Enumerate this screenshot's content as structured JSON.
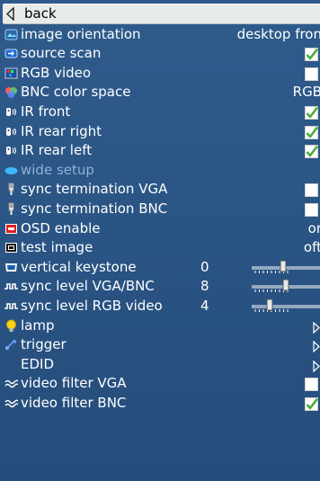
{
  "menu": {
    "back_label": "back",
    "items": [
      {
        "label": "image orientation",
        "value": "desktop fron",
        "icon": "image-orientation-icon",
        "kind": "value"
      },
      {
        "label": "source scan",
        "checked": true,
        "icon": "source-scan-icon",
        "kind": "check"
      },
      {
        "label": "RGB video",
        "checked": false,
        "icon": "rgb-video-icon",
        "kind": "check"
      },
      {
        "label": "BNC color space",
        "value": "RGB",
        "icon": "bnc-color-space-icon",
        "kind": "value"
      },
      {
        "label": "IR front",
        "checked": true,
        "icon": "ir-sensor-icon",
        "kind": "check"
      },
      {
        "label": "IR rear right",
        "checked": true,
        "icon": "ir-sensor-icon",
        "kind": "check"
      },
      {
        "label": "IR rear left",
        "checked": true,
        "icon": "ir-sensor-icon",
        "kind": "check"
      },
      {
        "label": "wide setup",
        "icon": "wide-setup-icon",
        "kind": "disabled"
      },
      {
        "label": "sync termination VGA",
        "checked": false,
        "icon": "sync-termination-icon",
        "kind": "check"
      },
      {
        "label": "sync termination BNC",
        "checked": false,
        "icon": "sync-termination-icon",
        "kind": "check"
      },
      {
        "label": "OSD enable",
        "value": "or",
        "icon": "osd-enable-icon",
        "kind": "value"
      },
      {
        "label": "test image",
        "value": "oft",
        "icon": "test-image-icon",
        "kind": "value"
      },
      {
        "label": "vertical keystone",
        "number": "0",
        "slider_fraction": 0.5,
        "icon": "vertical-keystone-icon",
        "kind": "slider"
      },
      {
        "label": "sync level VGA/BNC",
        "number": "8",
        "slider_fraction": 0.55,
        "icon": "sync-level-icon",
        "kind": "slider"
      },
      {
        "label": "sync level RGB video",
        "number": "4",
        "slider_fraction": 0.25,
        "icon": "sync-level-icon",
        "kind": "slider"
      },
      {
        "label": "lamp",
        "icon": "lamp-icon",
        "kind": "submenu"
      },
      {
        "label": "trigger",
        "icon": "trigger-icon",
        "kind": "submenu"
      },
      {
        "label": "EDID",
        "icon": "",
        "kind": "submenu"
      },
      {
        "label": "video filter VGA",
        "checked": false,
        "icon": "video-filter-icon",
        "kind": "check"
      },
      {
        "label": "video filter BNC",
        "checked": true,
        "icon": "video-filter-icon",
        "kind": "check"
      }
    ]
  },
  "colors": {
    "background": "#2a5483",
    "highlight": "#e7ebe9",
    "check": "#4cae3a"
  }
}
